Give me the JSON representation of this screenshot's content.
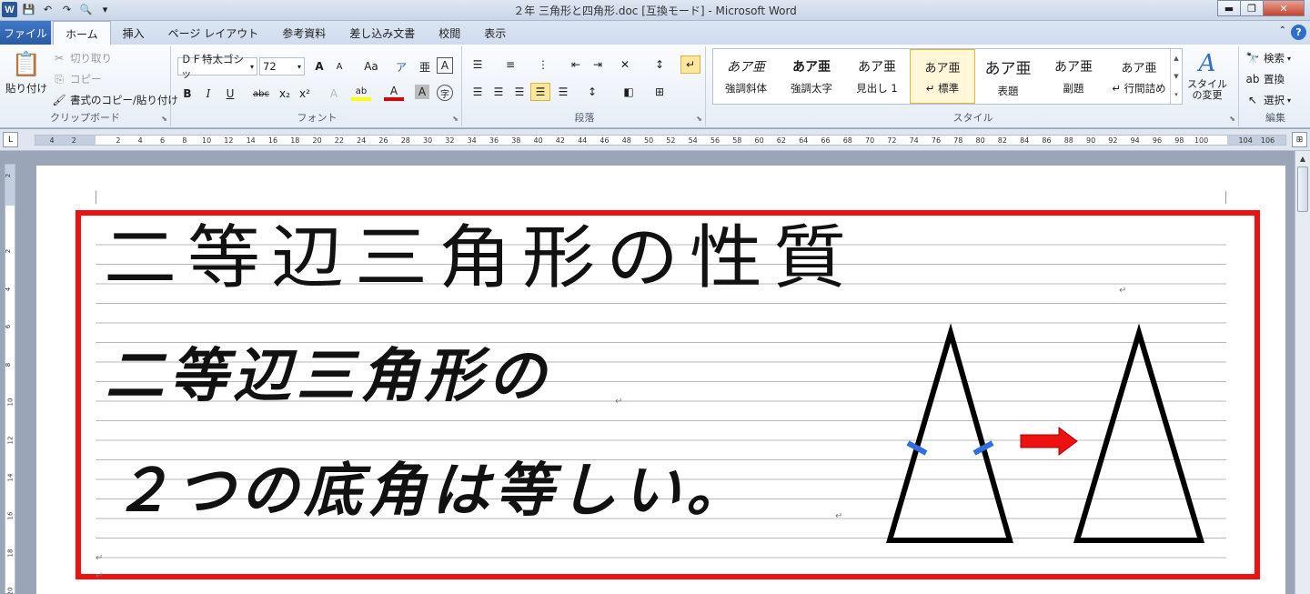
{
  "window": {
    "title": "２年 三角形と四角形.doc [互換モード] - Microsoft Word",
    "buttons": {
      "minimize": "▬",
      "restore": "❐",
      "close": "✕"
    }
  },
  "qat": {
    "app_icon": "W",
    "save": "💾",
    "undo": "↶",
    "redo": "↷",
    "print_preview": "🔍",
    "customize": "▾"
  },
  "tabs": {
    "file": "ファイル",
    "items": [
      "ホーム",
      "挿入",
      "ページ レイアウト",
      "参考資料",
      "差し込み文書",
      "校閲",
      "表示"
    ],
    "help": "?"
  },
  "clipboard": {
    "paste": "貼り付け",
    "cut": "切り取り",
    "copy": "コピー",
    "format_painter": "書式のコピー/貼り付け",
    "label": "クリップボード"
  },
  "font": {
    "name": "ＤＦ特太ゴシッ",
    "size": "72",
    "grow": "A",
    "shrink": "A",
    "case": "Aa",
    "clear": "ア",
    "phonetic": "亜",
    "border": "A",
    "bold": "B",
    "italic": "I",
    "underline": "U",
    "strike": "abc",
    "subscript": "x₂",
    "superscript": "x²",
    "effects": "A",
    "highlight": "ab",
    "color": "A",
    "shading": "A",
    "enclose": "字",
    "label": "フォント",
    "colors": {
      "highlight": "#ffff00",
      "font": "#e00000"
    }
  },
  "paragraph": {
    "label": "段落"
  },
  "styles": {
    "items": [
      {
        "sample": "あア亜",
        "label": "強調斜体"
      },
      {
        "sample": "あア亜",
        "label": "強調太字"
      },
      {
        "sample": "あア亜",
        "label": "見出し 1"
      },
      {
        "sample": "あア亜",
        "label": "↵ 標準"
      },
      {
        "sample": "あア亜",
        "label": "表題"
      },
      {
        "sample": "あア亜",
        "label": "副題"
      },
      {
        "sample": "あア亜",
        "label": "↵ 行間詰め"
      }
    ],
    "change_styles": "スタイルの変更",
    "label": "スタイル"
  },
  "editing": {
    "find": "検索",
    "replace": "置換",
    "select": "選択",
    "label": "編集"
  },
  "ruler": {
    "corner": "L",
    "numbers": [
      "4",
      "2",
      "",
      "2",
      "4",
      "6",
      "8",
      "10",
      "12",
      "14",
      "16",
      "18",
      "20",
      "22",
      "24",
      "26",
      "28",
      "30",
      "32",
      "34",
      "36",
      "38",
      "40",
      "42",
      "44",
      "46",
      "48",
      "50",
      "52",
      "54",
      "56",
      "58",
      "60",
      "62",
      "64",
      "66",
      "68",
      "70",
      "72",
      "74",
      "76",
      "78",
      "80",
      "82",
      "84",
      "86",
      "88",
      "90",
      "92",
      "94",
      "96",
      "98",
      "100",
      "",
      "104",
      "106"
    ],
    "vertical": [
      "2",
      "",
      "2",
      "4",
      "6",
      "8",
      "10",
      "12",
      "14",
      "16",
      "18",
      "20"
    ]
  },
  "document": {
    "heading": "二等辺三角形の性質",
    "line1": "二等辺三角形の",
    "line2": "２つの底角は等しい。",
    "paragraph_mark": "↵",
    "frame_color": "#ee1111",
    "tick_color": "#2f6fe0",
    "arrow_color": "#ee1111"
  }
}
